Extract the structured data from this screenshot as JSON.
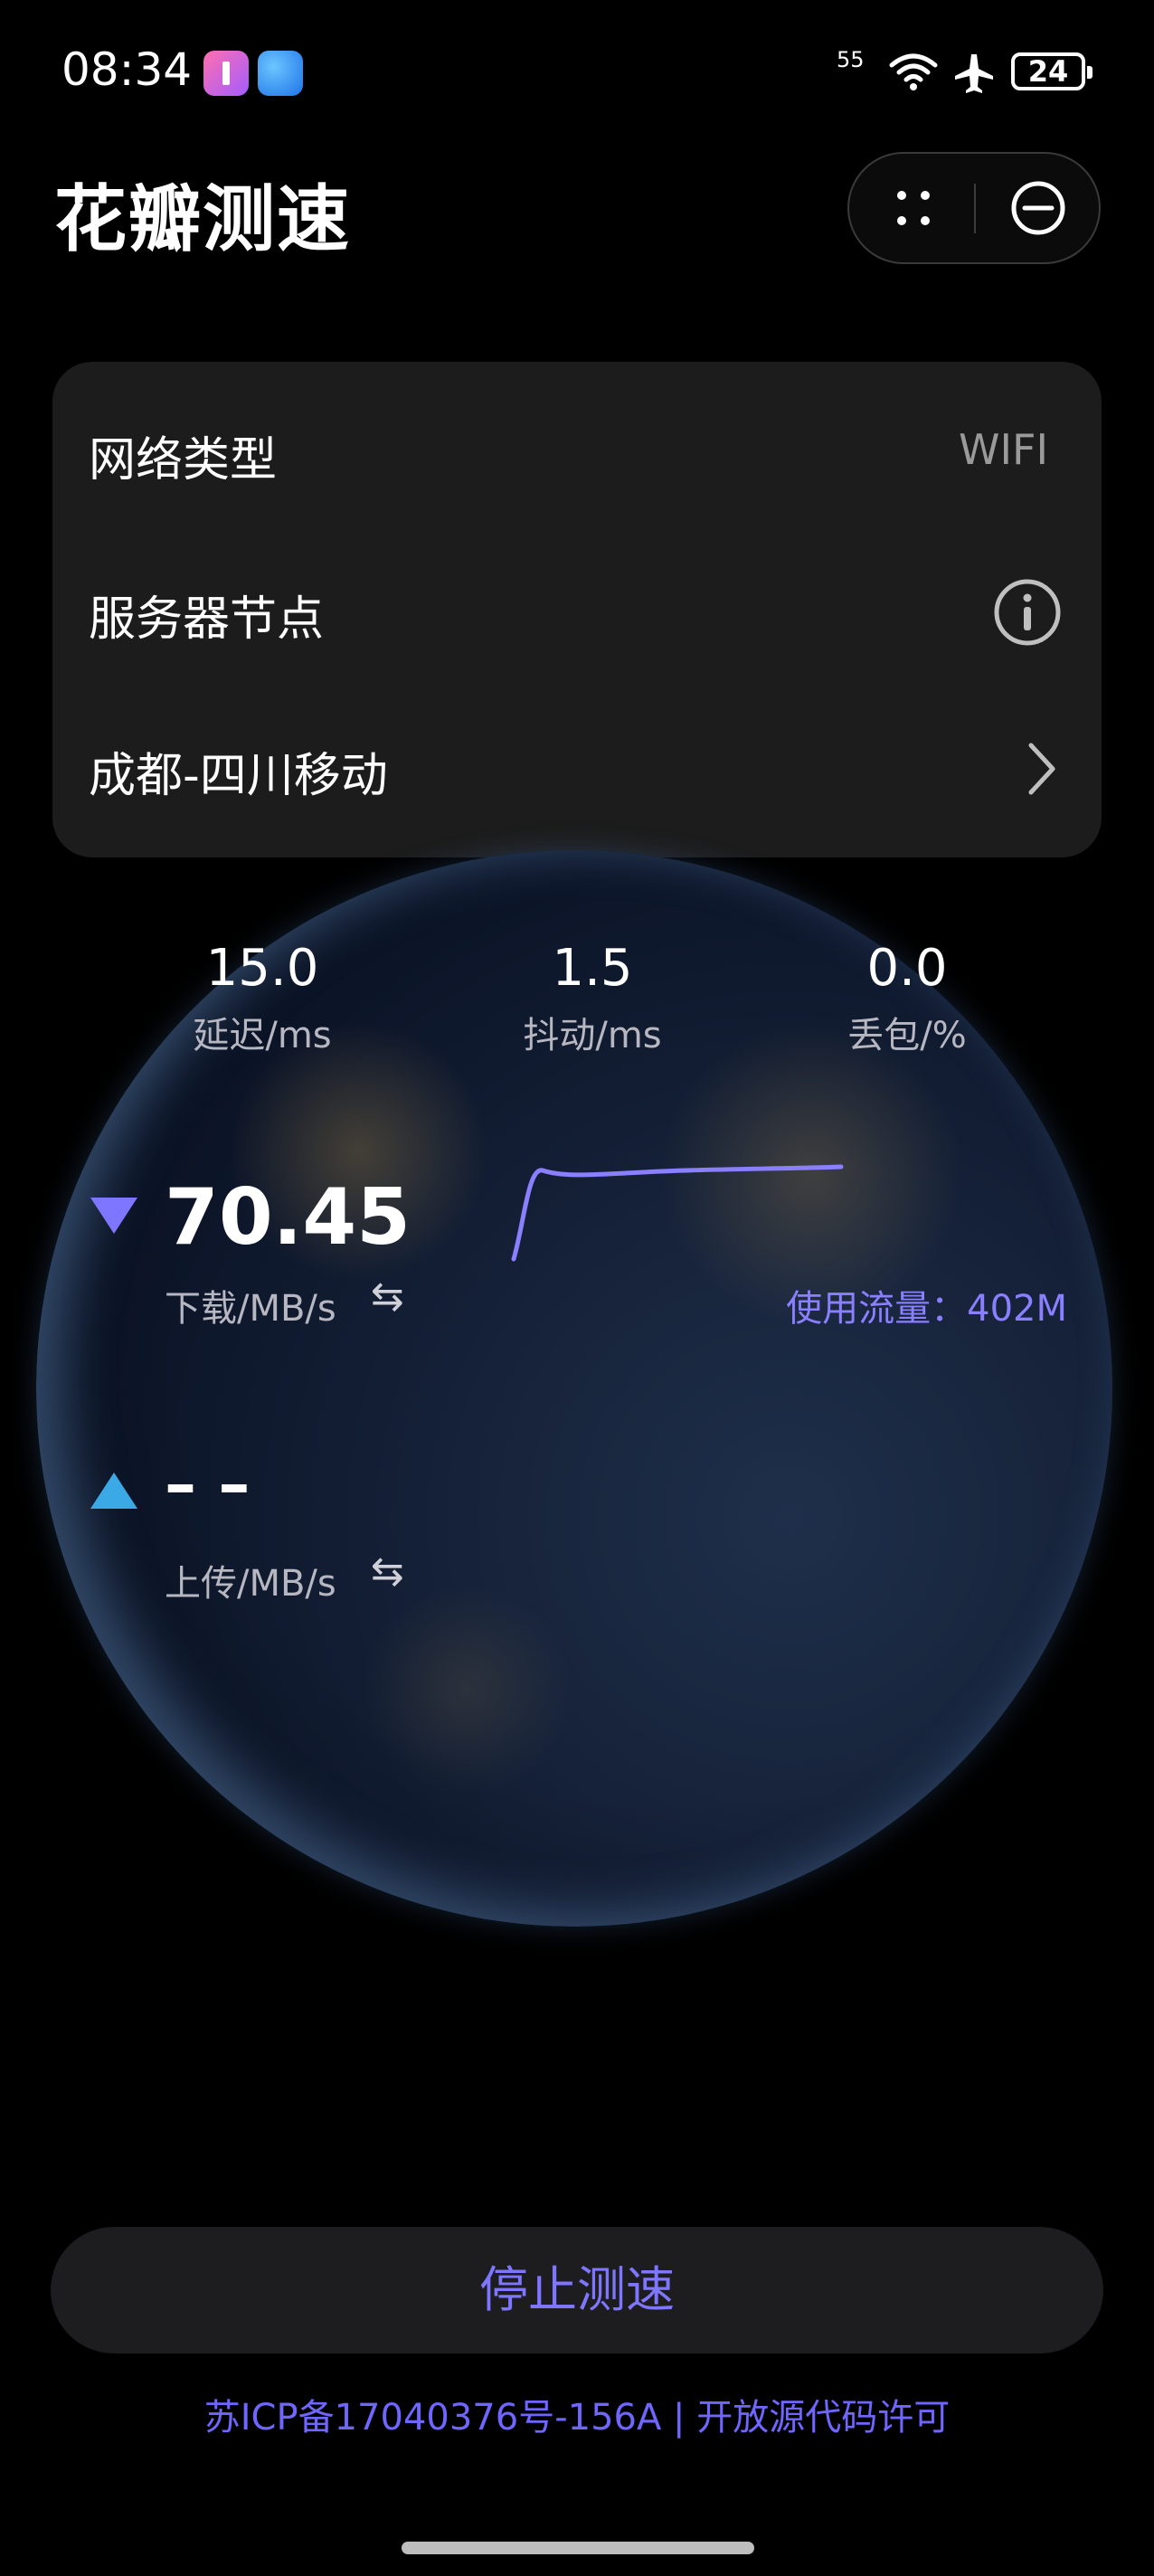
{
  "status_bar": {
    "time": "08:34",
    "signal_label": "55",
    "battery": "24",
    "icons": [
      "app-notification-pink-icon",
      "browser-app-icon",
      "wifi-6-icon",
      "airplane-icon",
      "battery-icon"
    ]
  },
  "header": {
    "title": "花瓣测速",
    "more_icon": "dots-grid-icon",
    "close_icon": "minus-circle-icon"
  },
  "info_card": {
    "network_type_label": "网络类型",
    "network_type_value": "WIFI",
    "server_node_label": "服务器节点",
    "server_node_info_icon": "info-circle-icon",
    "server_name": "成都-四川移动",
    "chevron_icon": "chevron-right-icon"
  },
  "metrics": {
    "latency": {
      "value": "15.0",
      "label": "延迟/ms"
    },
    "jitter": {
      "value": "1.5",
      "label": "抖动/ms"
    },
    "loss": {
      "value": "0.0",
      "label": "丢包/%"
    }
  },
  "download": {
    "value": "70.45",
    "label": "下载/MB/s",
    "swap_icon": "⇆",
    "arrow_color": "#7f76ff"
  },
  "upload": {
    "value": "– –",
    "label": "上传/MB/s",
    "swap_icon": "⇆",
    "arrow_color": "#3aa9e6"
  },
  "usage": {
    "text": "使用流量：402M"
  },
  "actions": {
    "stop_label": "停止测速"
  },
  "footer": {
    "text": "苏ICP备17040376号-156A | 开放源代码许可"
  },
  "colors": {
    "accent": "#7f76ff",
    "card_bg": "#1c1c1c",
    "background": "#000000"
  }
}
